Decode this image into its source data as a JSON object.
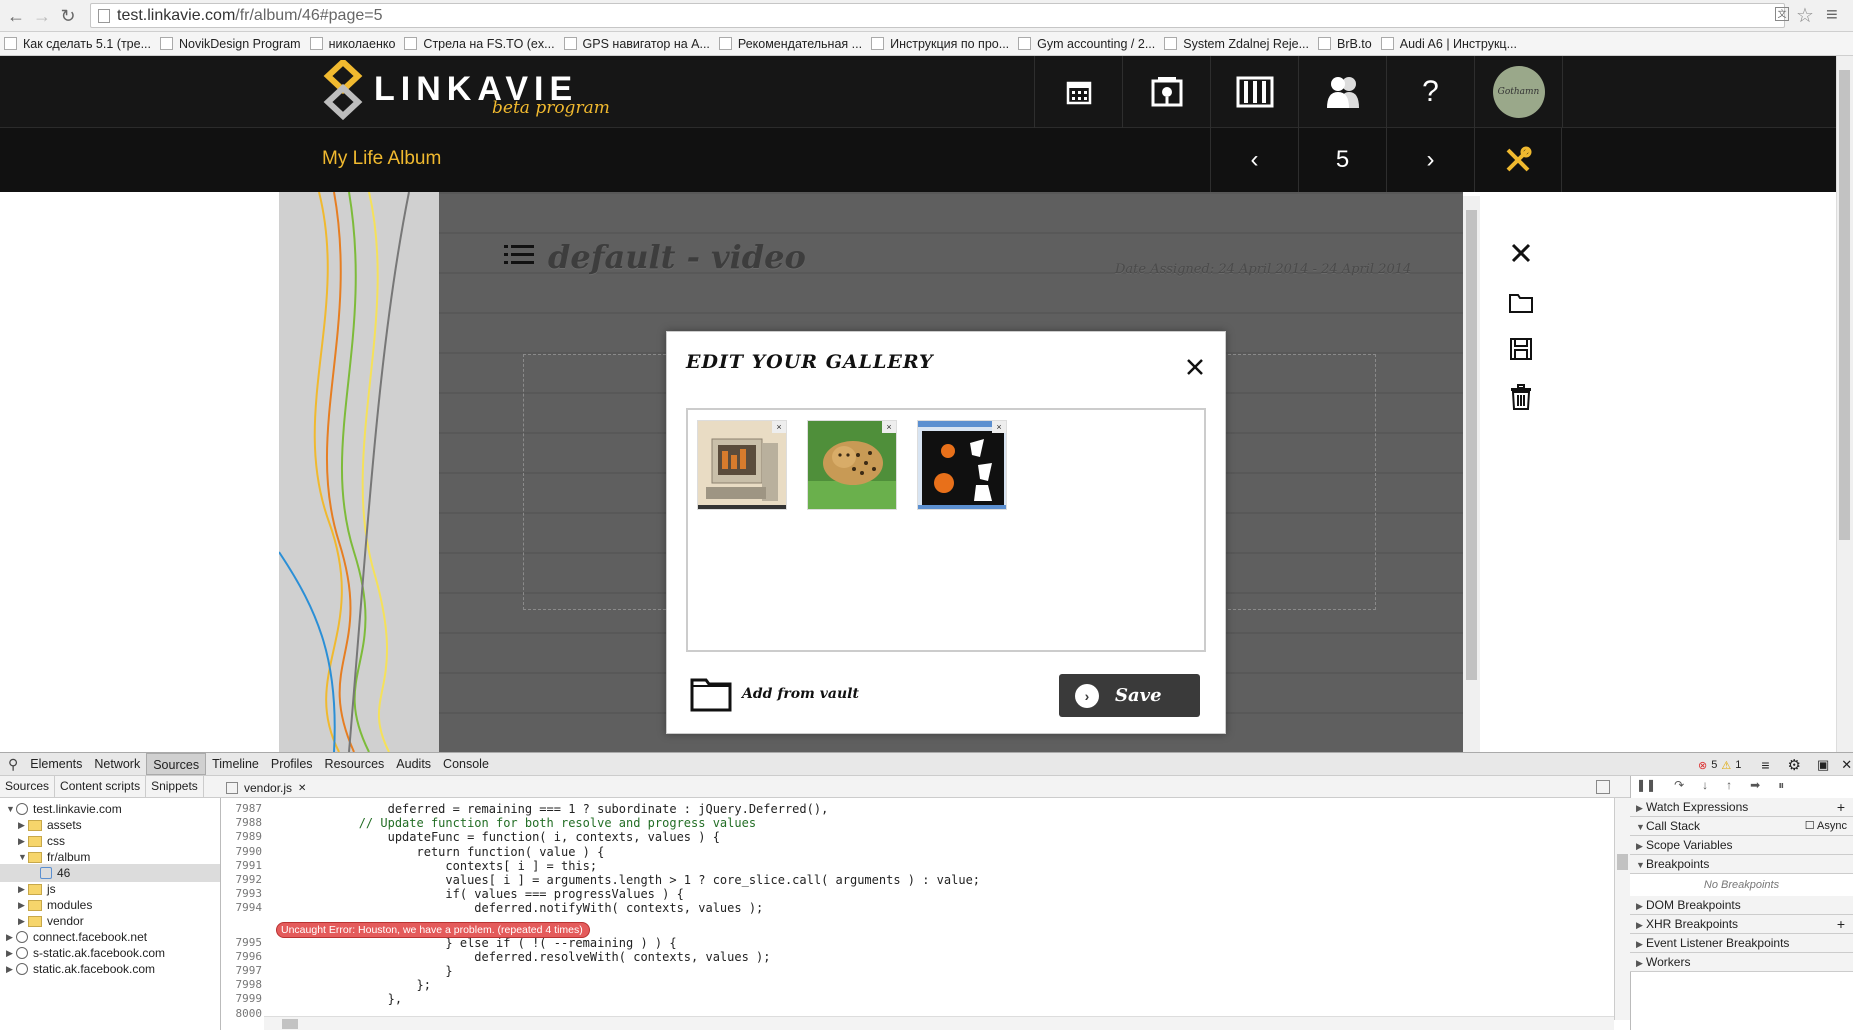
{
  "browser": {
    "url_host": "test.linkavie.com",
    "url_path": "/fr/album/46#page=5",
    "bookmarks": [
      "Как сделать 5.1 (тре...",
      "NovikDesign Program",
      "николаенко",
      "Стрела на FS.TO (ex...",
      "GPS навигатор на А...",
      "Рекомендательная ...",
      "Инструкция по про...",
      "Gym accounting / 2...",
      "System Zdalnej Reje...",
      "BrB.to",
      "Audi A6 | Инструкц..."
    ]
  },
  "site": {
    "logo_text": "LINKAVIE",
    "logo_sub": "beta program",
    "album_title": "My Life Album",
    "page_number": "5",
    "help_label": "?",
    "avatar_text": "Gothamn"
  },
  "board": {
    "title": "default - video",
    "date": "Date Assigned: 24 April 2014 - 24 April 2014"
  },
  "modal": {
    "title": "EDIT YOUR GALLERY",
    "close_label": "×",
    "thumb_close": "×",
    "add_from_vault": "Add from vault",
    "save_label": "Save"
  },
  "devtools": {
    "tabs": [
      "Elements",
      "Network",
      "Sources",
      "Timeline",
      "Profiles",
      "Resources",
      "Audits",
      "Console"
    ],
    "active_tab": "Sources",
    "error_count": "5",
    "warning_count": "1",
    "sub_tabs": [
      "Sources",
      "Content scripts",
      "Snippets"
    ],
    "open_file": "vendor.js",
    "tree": [
      {
        "label": "test.linkavie.com",
        "depth": 0,
        "type": "domain",
        "open": true
      },
      {
        "label": "assets",
        "depth": 1,
        "type": "folder",
        "open": false
      },
      {
        "label": "css",
        "depth": 1,
        "type": "folder",
        "open": false
      },
      {
        "label": "fr/album",
        "depth": 1,
        "type": "folder",
        "open": true
      },
      {
        "label": "46",
        "depth": 2,
        "type": "file",
        "selected": true
      },
      {
        "label": "js",
        "depth": 1,
        "type": "folder",
        "open": false
      },
      {
        "label": "modules",
        "depth": 1,
        "type": "folder",
        "open": false
      },
      {
        "label": "vendor",
        "depth": 1,
        "type": "folder",
        "open": false
      },
      {
        "label": "connect.facebook.net",
        "depth": 0,
        "type": "domain",
        "open": false
      },
      {
        "label": "s-static.ak.facebook.com",
        "depth": 0,
        "type": "domain",
        "open": false
      },
      {
        "label": "static.ak.facebook.com",
        "depth": 0,
        "type": "domain",
        "open": false
      }
    ],
    "code_lines": [
      {
        "n": "7987",
        "text": "                deferred = remaining === 1 ? subordinate : jQuery.Deferred(),"
      },
      {
        "n": "7988",
        "text": "            // Update function for both resolve and progress values",
        "comment": true
      },
      {
        "n": "7989",
        "text": "                updateFunc = function( i, contexts, values ) {"
      },
      {
        "n": "7990",
        "text": "                    return function( value ) {"
      },
      {
        "n": "7991",
        "text": "                        contexts[ i ] = this;"
      },
      {
        "n": "7992",
        "text": "                        values[ i ] = arguments.length > 1 ? core_slice.call( arguments ) : value;"
      },
      {
        "n": "7993",
        "text": "                        if( values === progressValues ) {"
      },
      {
        "n": "7994",
        "text": "                            deferred.notifyWith( contexts, values );"
      },
      {
        "n": "7995",
        "text": "                        } else if ( !( --remaining ) ) {"
      },
      {
        "n": "7996",
        "text": "                            deferred.resolveWith( contexts, values );"
      },
      {
        "n": "7997",
        "text": "                        }"
      },
      {
        "n": "7998",
        "text": "                    };"
      },
      {
        "n": "7999",
        "text": "                },"
      },
      {
        "n": "8000",
        "text": ""
      }
    ],
    "error_message": "Uncaught Error: Houston, we have a problem. (repeated 4 times)",
    "side_sections": [
      {
        "label": "Watch Expressions",
        "open": false
      },
      {
        "label": "Call Stack",
        "open": true
      },
      {
        "label": "Scope Variables",
        "open": false
      },
      {
        "label": "Breakpoints",
        "open": true
      },
      {
        "label": "DOM Breakpoints",
        "open": false
      },
      {
        "label": "XHR Breakpoints",
        "open": false
      },
      {
        "label": "Event Listener Breakpoints",
        "open": false
      },
      {
        "label": "Workers",
        "open": false
      }
    ],
    "async_label": "Async",
    "no_breakpoints": "No Breakpoints"
  },
  "colors": {
    "accent": "#f0b92f",
    "header": "#161616",
    "error": "#e45b5b"
  }
}
